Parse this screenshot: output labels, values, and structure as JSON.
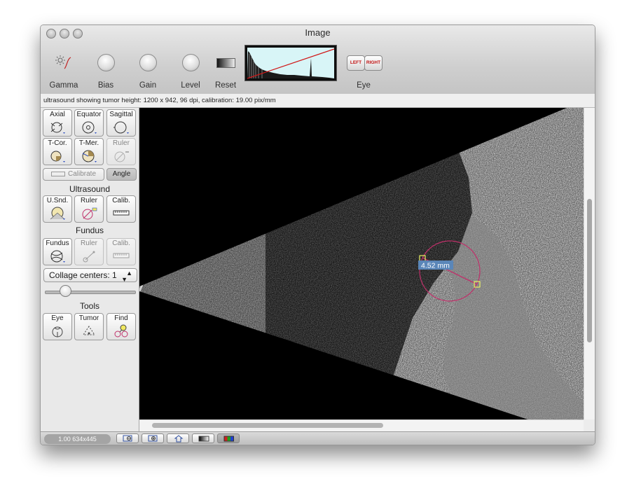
{
  "window": {
    "title": "Image",
    "traffic_lights": [
      "close",
      "minimize",
      "zoom"
    ]
  },
  "toolbar": {
    "items": [
      {
        "label": "Gamma",
        "icon": "gamma-icon"
      },
      {
        "label": "Bias",
        "icon": "knob-icon"
      },
      {
        "label": "Gain",
        "icon": "knob-icon"
      },
      {
        "label": "Level",
        "icon": "knob-icon"
      },
      {
        "label": "Reset",
        "icon": "gradient-icon"
      }
    ],
    "histogram_label": "",
    "eye": {
      "label": "Eye",
      "left": "LEFT",
      "right": "RIGHT"
    }
  },
  "info": {
    "text": "ultrasound showing tumor height: 1200 x 942, 96 dpi, calibration: 19.00 pix/mm"
  },
  "sidebar": {
    "projection_buttons": [
      {
        "label": "Axial",
        "enabled": true
      },
      {
        "label": "Equator",
        "enabled": true
      },
      {
        "label": "Sagittal",
        "enabled": true
      },
      {
        "label": "T-Cor.",
        "enabled": true
      },
      {
        "label": "T-Mer.",
        "enabled": true
      },
      {
        "label": "Ruler",
        "enabled": false
      }
    ],
    "calibrate": "Calibrate",
    "angle": "Angle",
    "ultrasound": {
      "title": "Ultrasound",
      "buttons": [
        {
          "label": "U.Snd.",
          "enabled": true
        },
        {
          "label": "Ruler",
          "enabled": true
        },
        {
          "label": "Calib.",
          "enabled": true
        }
      ]
    },
    "fundus": {
      "title": "Fundus",
      "buttons": [
        {
          "label": "Fundus",
          "enabled": true
        },
        {
          "label": "Ruler",
          "enabled": false
        },
        {
          "label": "Calib.",
          "enabled": false
        }
      ]
    },
    "collage": {
      "label": "Collage centers: 1"
    },
    "slider": {
      "value_fraction": 0.17
    },
    "tools": {
      "title": "Tools",
      "buttons": [
        {
          "label": "Eye",
          "enabled": true
        },
        {
          "label": "Tumor",
          "enabled": true
        },
        {
          "label": "Find",
          "enabled": true
        }
      ]
    }
  },
  "image": {
    "measurement_label": "4.52 mm",
    "annotation_color": "#c0306a",
    "label_bg": "#5a86b8",
    "handle_color": "#e8f060"
  },
  "statusbar": {
    "zoom": "1.00 634x445",
    "buttons": [
      "zoom-out",
      "zoom-in",
      "home",
      "grayscale",
      "color"
    ]
  },
  "colors": {
    "window_bg": "#ececec",
    "image_bg": "#000000"
  }
}
